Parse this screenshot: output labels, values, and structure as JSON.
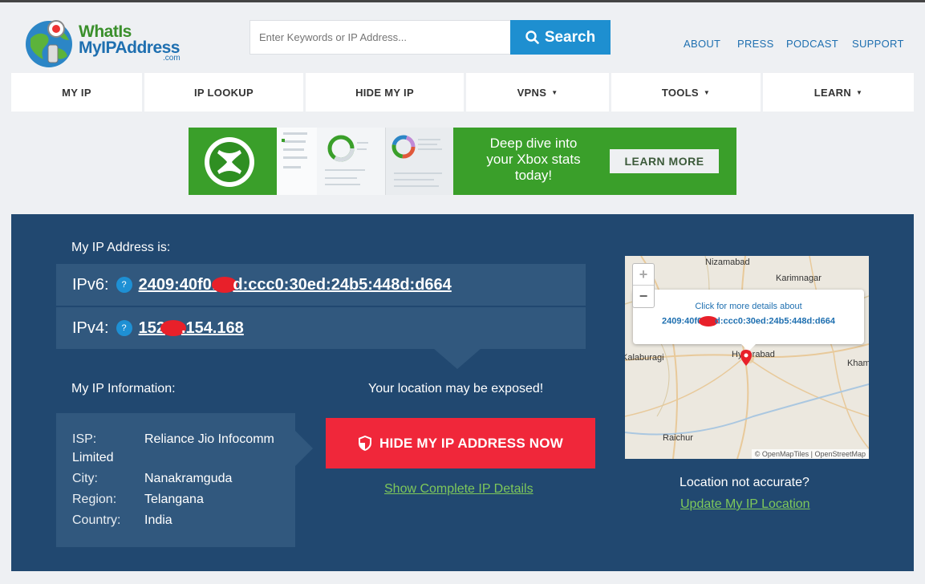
{
  "header": {
    "logo": {
      "line1_a": "What",
      "line1_b": "Is",
      "line2": "MyIPAddress",
      "com": ".com"
    },
    "search": {
      "placeholder": "Enter Keywords or IP Address...",
      "button_label": "Search"
    },
    "top_links": [
      "ABOUT",
      "PRESS",
      "PODCAST",
      "SUPPORT"
    ]
  },
  "nav": [
    {
      "label": "MY IP",
      "has_dropdown": false
    },
    {
      "label": "IP LOOKUP",
      "has_dropdown": false
    },
    {
      "label": "HIDE MY IP",
      "has_dropdown": false
    },
    {
      "label": "VPNS",
      "has_dropdown": true
    },
    {
      "label": "TOOLS",
      "has_dropdown": true
    },
    {
      "label": "LEARN",
      "has_dropdown": true
    }
  ],
  "nav_caret": "▼",
  "banner": {
    "text": "Deep dive into your Xbox stats today!",
    "button": "LEARN MORE"
  },
  "ip_section": {
    "heading": "My IP Address is:",
    "ipv6_label": "IPv6:",
    "ipv6_prefix": "2409:40f0:",
    "ipv6_suffix": "d:ccc0:30ed:24b5:448d:d664",
    "ipv4_label": "IPv4:",
    "ipv4_prefix": "152",
    "ipv4_suffix": ".154.168",
    "help_icon": "?"
  },
  "info_section": {
    "heading": "My IP Information:",
    "isp_label": "ISP:",
    "isp_value": "Reliance Jio Infocomm",
    "isp_value_cont": "Limited",
    "city_label": "City:",
    "city_value": "Nanakramguda",
    "region_label": "Region:",
    "region_value": "Telangana",
    "country_label": "Country:",
    "country_value": "India"
  },
  "privacy": {
    "warning": "Your location may be exposed!",
    "hide_button": "HIDE MY IP ADDRESS NOW",
    "details_link": "Show Complete IP Details"
  },
  "map": {
    "zoom_in": "+",
    "zoom_out": "−",
    "popup_title": "Click for more details about",
    "popup_ip_prefix": "2409:40f0",
    "popup_ip_suffix": "d:ccc0:30ed:24b5:448d:d664",
    "cities": [
      "Nizamabad",
      "Karimnagar",
      "Kalaburagi",
      "Hyderabad",
      "Kham",
      "Raichur"
    ],
    "attribution": "© OpenMapTiles | OpenStreetMap",
    "not_accurate": "Location not accurate?",
    "update_link": "Update My IP Location"
  },
  "colors": {
    "panel": "#214870",
    "accent_blue": "#1e8fd0",
    "red": "#f0273a",
    "green_link": "#7ec85a"
  }
}
